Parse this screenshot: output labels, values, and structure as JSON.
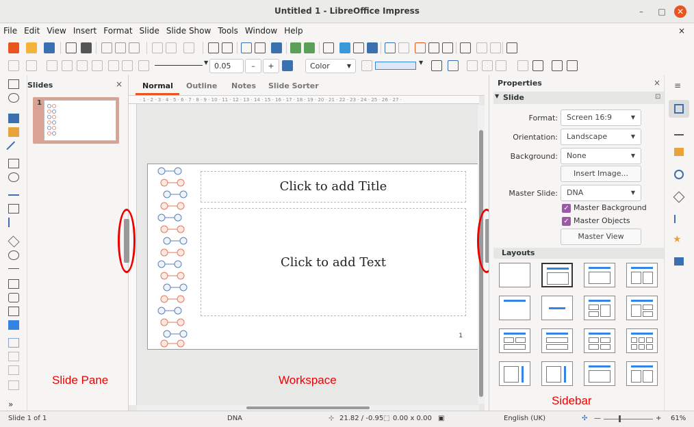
{
  "window": {
    "title": "Untitled 1 - LibreOffice Impress",
    "minimize": "–",
    "maximize": "□",
    "close": "✕"
  },
  "menu": [
    "File",
    "Edit",
    "View",
    "Insert",
    "Format",
    "Slide",
    "Slide Show",
    "Tools",
    "Window",
    "Help"
  ],
  "menu_close": "×",
  "toolbar2": {
    "line_width": "0.05 cm",
    "minus": "–",
    "plus": "+",
    "fill": "Color"
  },
  "slides_pane": {
    "title": "Slides",
    "close": "×",
    "slide_number": "1"
  },
  "tabs": [
    "Normal",
    "Outline",
    "Notes",
    "Slide Sorter"
  ],
  "slide": {
    "title_placeholder": "Click to add Title",
    "text_placeholder": "Click to add Text",
    "page_number": "1"
  },
  "sidebar": {
    "title": "Properties",
    "close": "×",
    "menu": "≡",
    "section": "Slide",
    "format_label": "Format:",
    "format_value": "Screen 16:9",
    "orientation_label": "Orientation:",
    "orientation_value": "Landscape",
    "background_label": "Background:",
    "background_value": "None",
    "insert_image": "Insert Image...",
    "master_slide_label": "Master Slide:",
    "master_slide_value": "DNA",
    "master_background": "Master Background",
    "master_objects": "Master Objects",
    "master_view": "Master View",
    "layouts_title": "Layouts"
  },
  "annotations": {
    "slide_pane": "Slide Pane",
    "workspace": "Workspace",
    "sidebar": "Sidebar"
  },
  "status": {
    "slide": "Slide 1 of 1",
    "master": "DNA",
    "position": "21.82 / -0.95",
    "size": "0.00 x 0.00",
    "language": "English (UK)",
    "zoom": "61%"
  },
  "colors": {
    "accent": "#e95420",
    "annotation": "#ee0000",
    "checkbox": "#9a5aa7",
    "blue_dna": "#5b7fb5",
    "orange_dna": "#e8765a"
  }
}
